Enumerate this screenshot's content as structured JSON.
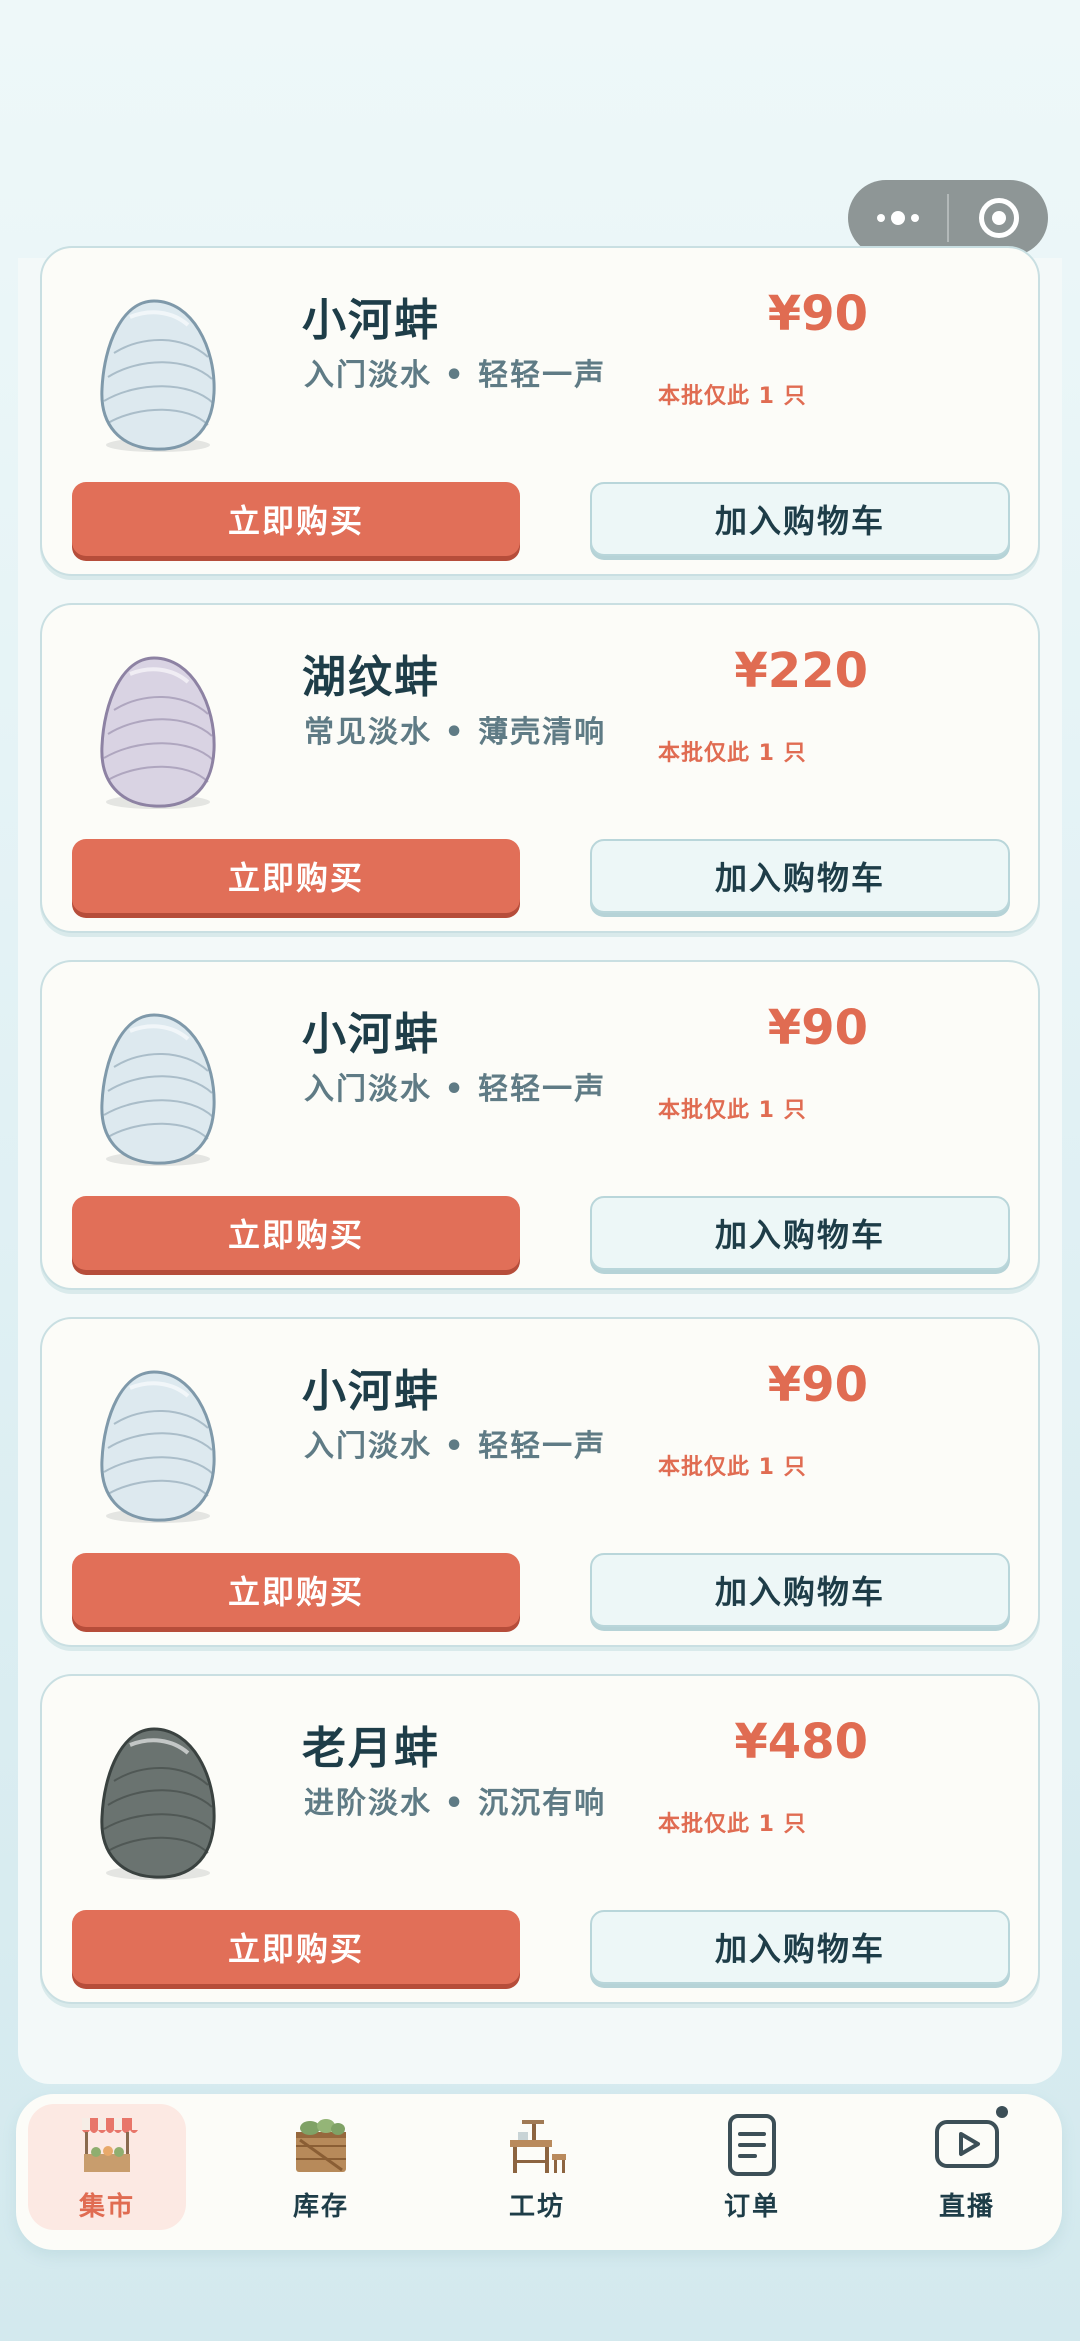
{
  "products": [
    {
      "name": "小河蚌",
      "desc": "入门淡水 • 轻轻一声",
      "price": "¥90",
      "stock": "本批仅此 1 只",
      "buy_label": "立即购买",
      "cart_label": "加入购物车",
      "shell_color": "#dde9ef",
      "shell_stroke": "#7f99aa"
    },
    {
      "name": "湖纹蚌",
      "desc": "常见淡水 • 薄壳清响",
      "price": "¥220",
      "stock": "本批仅此 1 只",
      "buy_label": "立即购买",
      "cart_label": "加入购物车",
      "shell_color": "#d9d3e3",
      "shell_stroke": "#8d82a3"
    },
    {
      "name": "小河蚌",
      "desc": "入门淡水 • 轻轻一声",
      "price": "¥90",
      "stock": "本批仅此 1 只",
      "buy_label": "立即购买",
      "cart_label": "加入购物车",
      "shell_color": "#dde9ef",
      "shell_stroke": "#7f99aa"
    },
    {
      "name": "小河蚌",
      "desc": "入门淡水 • 轻轻一声",
      "price": "¥90",
      "stock": "本批仅此 1 只",
      "buy_label": "立即购买",
      "cart_label": "加入购物车",
      "shell_color": "#dde9ef",
      "shell_stroke": "#7f99aa"
    },
    {
      "name": "老月蚌",
      "desc": "进阶淡水 • 沉沉有响",
      "price": "¥480",
      "stock": "本批仅此 1 只",
      "buy_label": "立即购买",
      "cart_label": "加入购物车",
      "shell_color": "#6a7370",
      "shell_stroke": "#3a4240"
    }
  ],
  "tabs": [
    {
      "label": "集市",
      "icon": "market-stall-icon",
      "active": true
    },
    {
      "label": "库存",
      "icon": "crate-icon",
      "active": false
    },
    {
      "label": "工坊",
      "icon": "workbench-icon",
      "active": false
    },
    {
      "label": "订单",
      "icon": "order-document-icon",
      "active": false
    },
    {
      "label": "直播",
      "icon": "live-play-icon",
      "active": false
    }
  ],
  "colors": {
    "accent": "#e06c52",
    "primary_text": "#1e3d48",
    "secondary_text": "#5f7b85",
    "card_bg": "#fcfcf8",
    "cart_button_bg": "#edf7f7"
  }
}
